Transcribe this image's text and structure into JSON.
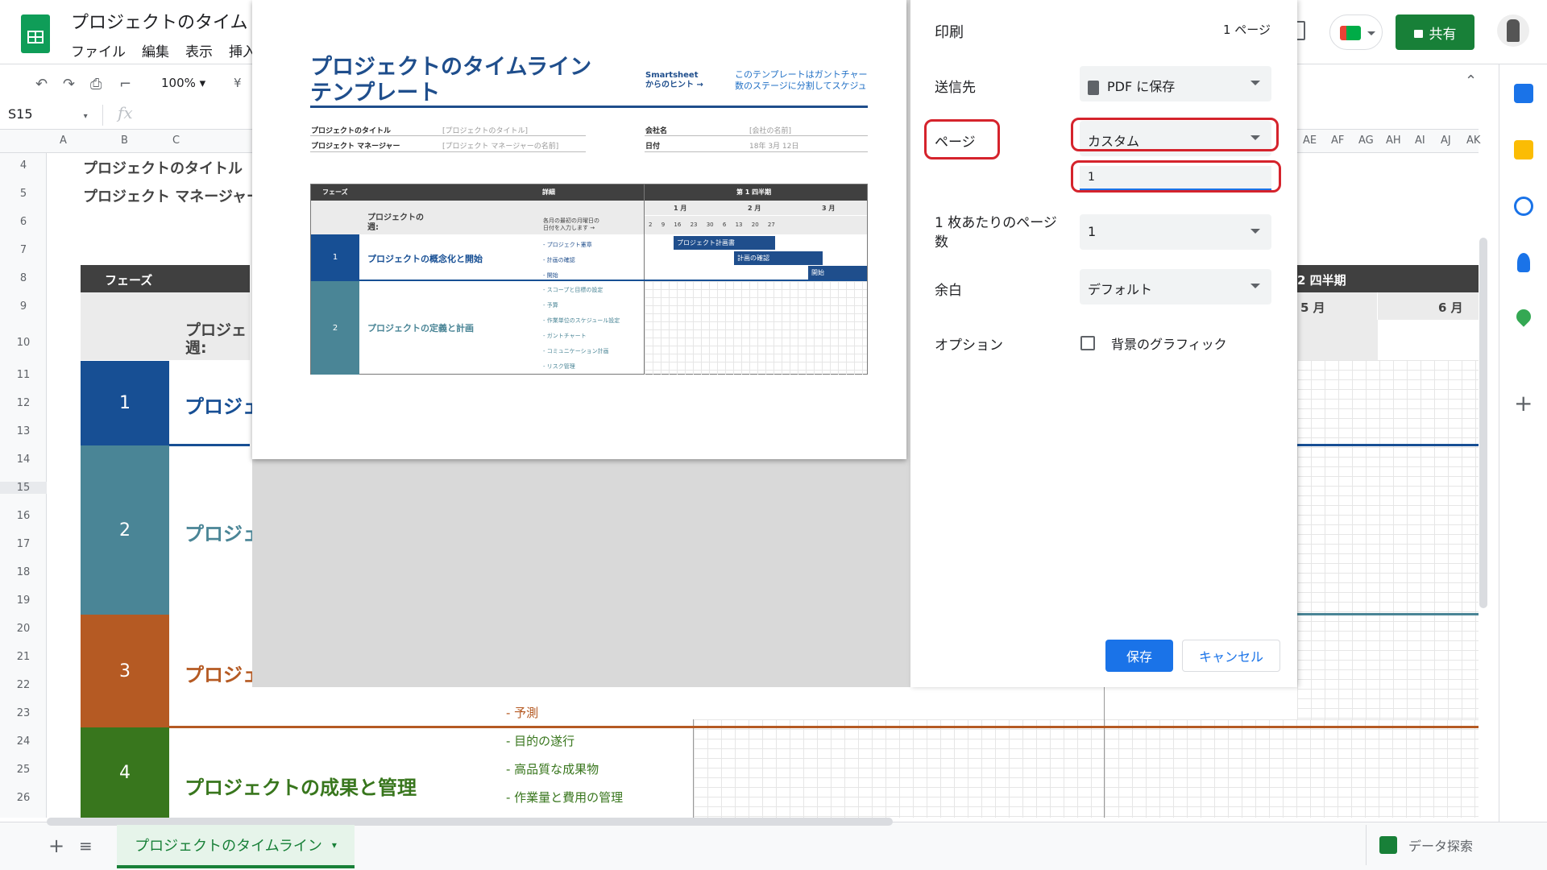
{
  "app": {
    "doc_title": "プロジェクトのタイム",
    "menu": [
      "ファイル",
      "編集",
      "表示",
      "挿入"
    ],
    "share_label": "共有"
  },
  "toolbar": {
    "zoom": "100%",
    "currency": "¥",
    "name_box": "S15",
    "fx": "fx"
  },
  "columns": {
    "left": [
      "A",
      "B",
      "C"
    ],
    "right": [
      "AE",
      "AF",
      "AG",
      "AH",
      "AI",
      "AJ",
      "AK"
    ]
  },
  "rows": [
    "4",
    "5",
    "6",
    "7",
    "8",
    "9",
    "10",
    "11",
    "12",
    "13",
    "14",
    "15",
    "16",
    "17",
    "18",
    "19",
    "20",
    "21",
    "22",
    "23",
    "24",
    "25",
    "26"
  ],
  "sheet": {
    "project_title_label": "プロジェクトのタイトル",
    "project_manager_label": "プロジェクト マネージャー",
    "phase_header": "フェーズ",
    "week_label": "プロジェ\n週:",
    "quarter_right": "2 四半期",
    "month_may": "5 月",
    "month_jun": "6 月",
    "phases": [
      {
        "num": "1",
        "name": "プロジェ",
        "color": "#174f94"
      },
      {
        "num": "2",
        "name": "プロジェ",
        "color": "#4a8596"
      },
      {
        "num": "3",
        "name": "プロジェ",
        "color": "#b55a23"
      },
      {
        "num": "4",
        "name": "プロジェクトの成果と管理",
        "color": "#38761d"
      }
    ],
    "tasks": [
      "- 予測",
      "- 目的の遂行",
      "- 高品質な成果物",
      "- 作業量と費用の管理"
    ]
  },
  "preview": {
    "title": "プロジェクトのタイムライン テンプレート",
    "smartsheet": "Smartsheet\nからのヒント →",
    "tip": "このテンプレートはガントチャー\n数のステージに分割してスケジュ",
    "field_title": "プロジェクトのタイトル",
    "field_title_val": "[プロジェクトのタイトル]",
    "field_pm": "プロジェクト マネージャー",
    "field_pm_val": "[プロジェクト マネージャーの名前]",
    "field_company": "会社名",
    "field_company_val": "[会社の名前]",
    "field_date": "日付",
    "field_date_val": "18年 3月 12日",
    "tbl_phase": "フェーズ",
    "tbl_detail": "詳細",
    "tbl_q1": "第 1 四半期",
    "tbl_week": "プロジェクトの\n週:",
    "tbl_week_hint": "各月の最初の月曜日の\n日付を入力します →",
    "months": [
      "1 月",
      "2 月",
      "3 月"
    ],
    "days": [
      "2",
      "9",
      "16",
      "23",
      "30",
      "6",
      "13",
      "20",
      "27"
    ],
    "phase1_num": "1",
    "phase1_name": "プロジェクトの概念化と開始",
    "phase1_tasks": [
      "- プロジェクト憲章",
      "- 計画の確認",
      "- 開始"
    ],
    "phase2_num": "2",
    "phase2_name": "プロジェクトの定義と計画",
    "phase2_tasks": [
      "- スコープと目標の設定",
      "- 予算",
      "- 作業単位のスケジュール設定",
      "- ガントチャート",
      "- コミュニケーション計画",
      "- リスク管理"
    ],
    "bars": [
      "プロジェクト計画書",
      "計画の確認",
      "開始"
    ]
  },
  "print": {
    "title": "印刷",
    "pages_count": "1 ページ",
    "dest_label": "送信先",
    "dest_value": "PDF に保存",
    "pages_label": "ページ",
    "pages_value": "カスタム",
    "custom_pages": "1",
    "per_sheet_label": "1 枚あたりのページ数",
    "per_sheet_value": "1",
    "margin_label": "余白",
    "margin_value": "デフォルト",
    "options_label": "オプション",
    "bg_graphics_label": "背景のグラフィック",
    "bg_graphics_checked": false,
    "save_label": "保存",
    "cancel_label": "キャンセル"
  },
  "bottom": {
    "sheet_tab": "プロジェクトのタイムライン",
    "explore": "データ探索"
  }
}
